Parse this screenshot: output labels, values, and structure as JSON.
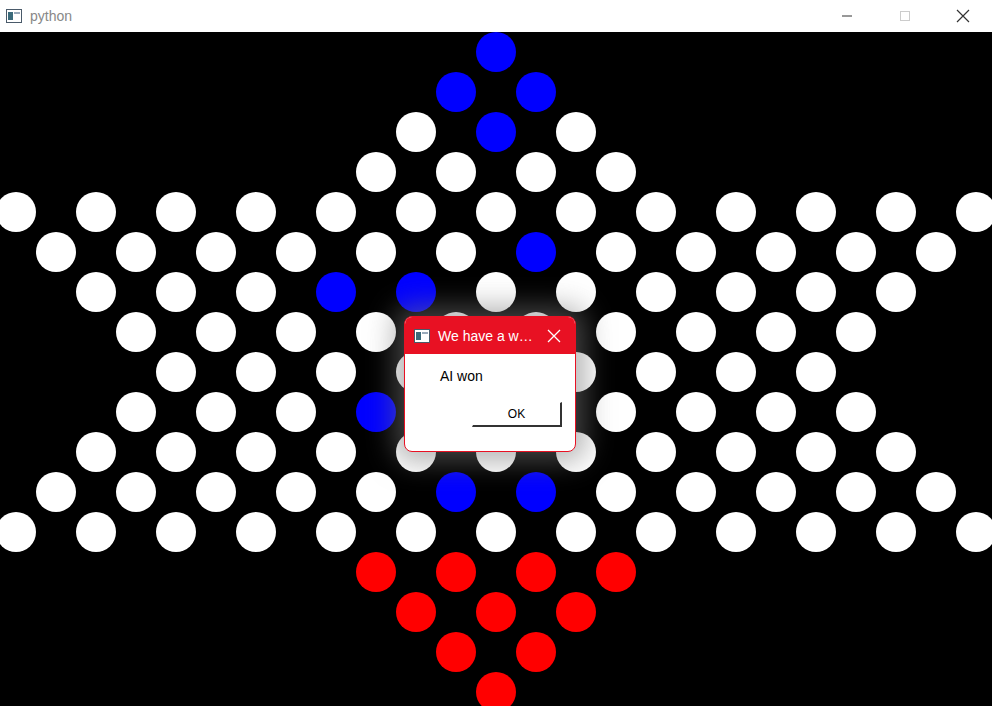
{
  "window": {
    "title": "python"
  },
  "board": {
    "rows": [
      [
        "#0000ff"
      ],
      [
        "#0000ff",
        "#0000ff"
      ],
      [
        "#ffffff",
        "#0000ff",
        "#ffffff"
      ],
      [
        "#ffffff",
        "#ffffff",
        "#ffffff",
        "#ffffff"
      ],
      [
        "#ffffff",
        "#ffffff",
        "#ffffff",
        "#ffffff",
        "#ffffff",
        "#ffffff",
        "#ffffff",
        "#ffffff",
        "#ffffff",
        "#ffffff",
        "#ffffff",
        "#ffffff",
        "#ffffff"
      ],
      [
        "#ffffff",
        "#ffffff",
        "#ffffff",
        "#ffffff",
        "#ffffff",
        "#ffffff",
        "#0000ff",
        "#ffffff",
        "#ffffff",
        "#ffffff",
        "#ffffff",
        "#ffffff"
      ],
      [
        "#ffffff",
        "#ffffff",
        "#ffffff",
        "#0000ff",
        "#0000ff",
        "#ffffff",
        "#ffffff",
        "#ffffff",
        "#ffffff",
        "#ffffff",
        "#ffffff"
      ],
      [
        "#ffffff",
        "#ffffff",
        "#ffffff",
        "#ffffff",
        "#ffffff",
        "#ffffff",
        "#ffffff",
        "#ffffff",
        "#ffffff",
        "#ffffff"
      ],
      [
        "#ffffff",
        "#ffffff",
        "#ffffff",
        "#ffffff",
        "#ffffff",
        "#ffffff",
        "#ffffff",
        "#ffffff",
        "#ffffff"
      ],
      [
        "#ffffff",
        "#ffffff",
        "#ffffff",
        "#0000ff",
        "#ffffff",
        "#ffffff",
        "#ffffff",
        "#ffffff",
        "#ffffff",
        "#ffffff"
      ],
      [
        "#ffffff",
        "#ffffff",
        "#ffffff",
        "#ffffff",
        "#ffffff",
        "#ffffff",
        "#ffffff",
        "#ffffff",
        "#ffffff",
        "#ffffff",
        "#ffffff"
      ],
      [
        "#ffffff",
        "#ffffff",
        "#ffffff",
        "#ffffff",
        "#ffffff",
        "#0000ff",
        "#0000ff",
        "#ffffff",
        "#ffffff",
        "#ffffff",
        "#ffffff",
        "#ffffff"
      ],
      [
        "#ffffff",
        "#ffffff",
        "#ffffff",
        "#ffffff",
        "#ffffff",
        "#ffffff",
        "#ffffff",
        "#ffffff",
        "#ffffff",
        "#ffffff",
        "#ffffff",
        "#ffffff",
        "#ffffff"
      ],
      [
        "#ff0000",
        "#ff0000",
        "#ff0000",
        "#ff0000"
      ],
      [
        "#ff0000",
        "#ff0000",
        "#ff0000"
      ],
      [
        "#ff0000",
        "#ff0000"
      ],
      [
        "#ff0000"
      ]
    ]
  },
  "dialog": {
    "title": "We have a w…",
    "message": "AI won",
    "buttons": [
      "OK"
    ]
  }
}
